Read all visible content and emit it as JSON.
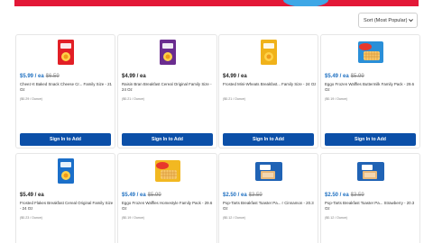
{
  "sort": {
    "label": "Sort (Most Popular)"
  },
  "action_label": "Sign In to Add",
  "products": [
    {
      "name": "Cheez-It Baked Snack Cheese Cr... Family Size - 21 Oz",
      "price": "$5.99 / ea",
      "was": "$6.59",
      "unit": "($0.29 / Ounce)",
      "sale": true,
      "color": "#e21f26",
      "icon": "cereal-box-icon"
    },
    {
      "name": "Raisin Bran Breakfast Cereal Original Family Size - 24 Oz",
      "price": "$4.99 / ea",
      "was": "",
      "unit": "($0.21 / Ounce)",
      "sale": false,
      "color": "#6a2c8f",
      "icon": "cereal-box-icon"
    },
    {
      "name": "Frosted Mini-Wheats Breakfast... Family Size - 24 Oz",
      "price": "$4.99 / ea",
      "was": "",
      "unit": "($0.21 / Ounce)",
      "sale": false,
      "color": "#f0b21a",
      "icon": "cereal-box-icon"
    },
    {
      "name": "Eggo Frozen Waffles Buttermilk Family Pack - 29.6 Oz",
      "price": "$5.49 / ea",
      "was": "$5.99",
      "unit": "($0.19 / Ounce)",
      "sale": true,
      "color": "#2a8fd8",
      "icon": "waffle-box-icon"
    },
    {
      "name": "Frosted Flakes Breakfast Cereal Original Family Size - 24 Oz",
      "price": "$5.49 / ea",
      "was": "",
      "unit": "($0.23 / Ounce)",
      "sale": false,
      "color": "#1b6fc9",
      "icon": "cereal-box-icon"
    },
    {
      "name": "Eggo Frozen Waffles Homestyle Family Pack - 29.6 Oz",
      "price": "$5.49 / ea",
      "was": "$5.99",
      "unit": "($0.19 / Ounce)",
      "sale": true,
      "color": "#f2b821",
      "icon": "waffle-box-icon"
    },
    {
      "name": "Pop-Tarts Breakfast Toaster Pa... r Cinnamon - 20.3 Oz",
      "price": "$2.50 / ea",
      "was": "$3.59",
      "unit": "($0.12 / Ounce)",
      "sale": true,
      "color": "#2063b5",
      "icon": "pastry-box-icon"
    },
    {
      "name": "Pop-Tarts Breakfast Toaster Pa... Strawberry - 20.3 Oz",
      "price": "$2.50 / ea",
      "was": "$3.59",
      "unit": "($0.12 / Ounce)",
      "sale": true,
      "color": "#2063b5",
      "icon": "pastry-box-icon"
    }
  ]
}
